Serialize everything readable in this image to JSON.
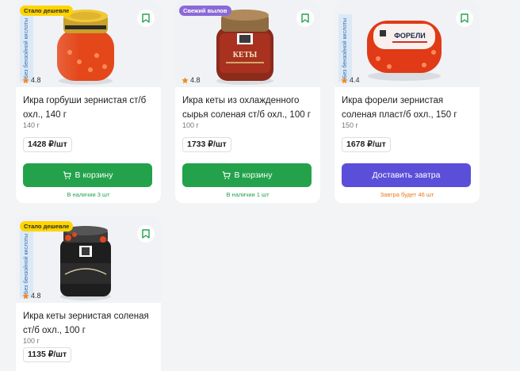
{
  "products": [
    {
      "side_label": "Без бензойной кислоты",
      "badge": "Стало дешевле",
      "rating": "4.8",
      "title": "Икра горбуши зернистая ст/б охл., 140 г",
      "weight": "140 г",
      "price": "1428 ₽/шт",
      "button": "В корзину",
      "note": "В наличии 3 шт"
    },
    {
      "side_label": "",
      "badge": "Свежий вылов",
      "rating": "4.8",
      "title": "Икра кеты из охлажденного сырья соленая ст/б охл., 100 г",
      "weight": "100 г",
      "price": "1733 ₽/шт",
      "button": "В корзину",
      "note": "В наличии 1 шт"
    },
    {
      "side_label": "Без бензойной кислоты",
      "badge": "",
      "rating": "4.4",
      "title": "Икра форели зернистая соленая пласт/б охл., 150 г",
      "weight": "150 г",
      "price": "1678 ₽/шт",
      "button": "Доставить завтра",
      "note": "Завтра будет 46 шт"
    },
    {
      "side_label": "Без бензойной кислоты",
      "badge": "Стало дешевле",
      "rating": "4.8",
      "title": "Икра кеты зернистая соленая ст/б охл., 100 г",
      "weight": "100 г",
      "price": "1135 ₽/шт",
      "button": "",
      "note": ""
    }
  ],
  "package_labels": {
    "keta_jar": "КЕТЫ",
    "foreli_box": "ФОРЕЛИ"
  },
  "icons": {
    "bookmark": "bookmark-icon",
    "star": "star-icon",
    "cart": "cart-icon"
  },
  "colors": {
    "green_button": "#23a24b",
    "violet_button": "#5b4fd9",
    "badge_yellow": "#ffd500",
    "badge_purple": "#8b6ad6",
    "star": "#f08a24",
    "note_orange": "#e47a1f"
  }
}
